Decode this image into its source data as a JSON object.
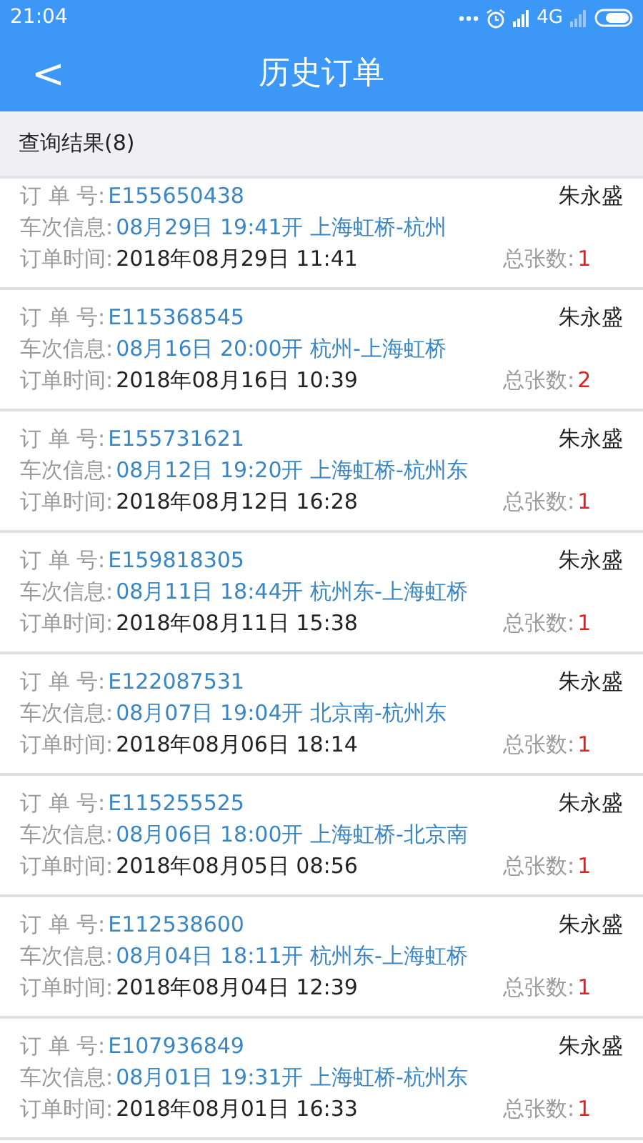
{
  "status_bar": {
    "time": "21:04",
    "network": "4G"
  },
  "header": {
    "back": "<",
    "title": "历史订单"
  },
  "results": {
    "label": "查询结果(8)"
  },
  "orders": [
    {
      "order_label": "订 单 号:",
      "order_no": "E155650438",
      "passenger": "朱永盛",
      "train_label": "车次信息:",
      "train": "08月29日 19:41开 上海虹桥-杭州",
      "time_label": "订单时间:",
      "time": "2018年08月29日 11:41",
      "count_label": "总张数:",
      "count": "1"
    },
    {
      "order_label": "订 单 号:",
      "order_no": "E115368545",
      "passenger": "朱永盛",
      "train_label": "车次信息:",
      "train": "08月16日 20:00开 杭州-上海虹桥",
      "time_label": "订单时间:",
      "time": "2018年08月16日 10:39",
      "count_label": "总张数:",
      "count": "2"
    },
    {
      "order_label": "订 单 号:",
      "order_no": "E155731621",
      "passenger": "朱永盛",
      "train_label": "车次信息:",
      "train": "08月12日 19:20开 上海虹桥-杭州东",
      "time_label": "订单时间:",
      "time": "2018年08月12日 16:28",
      "count_label": "总张数:",
      "count": "1"
    },
    {
      "order_label": "订 单 号:",
      "order_no": "E159818305",
      "passenger": "朱永盛",
      "train_label": "车次信息:",
      "train": "08月11日 18:44开 杭州东-上海虹桥",
      "time_label": "订单时间:",
      "time": "2018年08月11日 15:38",
      "count_label": "总张数:",
      "count": "1"
    },
    {
      "order_label": "订 单 号:",
      "order_no": "E122087531",
      "passenger": "朱永盛",
      "train_label": "车次信息:",
      "train": "08月07日 19:04开 北京南-杭州东",
      "time_label": "订单时间:",
      "time": "2018年08月06日 18:14",
      "count_label": "总张数:",
      "count": "1"
    },
    {
      "order_label": "订 单 号:",
      "order_no": "E115255525",
      "passenger": "朱永盛",
      "train_label": "车次信息:",
      "train": "08月06日 18:00开 上海虹桥-北京南",
      "time_label": "订单时间:",
      "time": "2018年08月05日 08:56",
      "count_label": "总张数:",
      "count": "1"
    },
    {
      "order_label": "订 单 号:",
      "order_no": "E112538600",
      "passenger": "朱永盛",
      "train_label": "车次信息:",
      "train": "08月04日 18:11开 杭州东-上海虹桥",
      "time_label": "订单时间:",
      "time": "2018年08月04日 12:39",
      "count_label": "总张数:",
      "count": "1"
    },
    {
      "order_label": "订 单 号:",
      "order_no": "E107936849",
      "passenger": "朱永盛",
      "train_label": "车次信息:",
      "train": "08月01日 19:31开 上海虹桥-杭州东",
      "time_label": "订单时间:",
      "time": "2018年08月01日 16:33",
      "count_label": "总张数:",
      "count": "1"
    }
  ]
}
